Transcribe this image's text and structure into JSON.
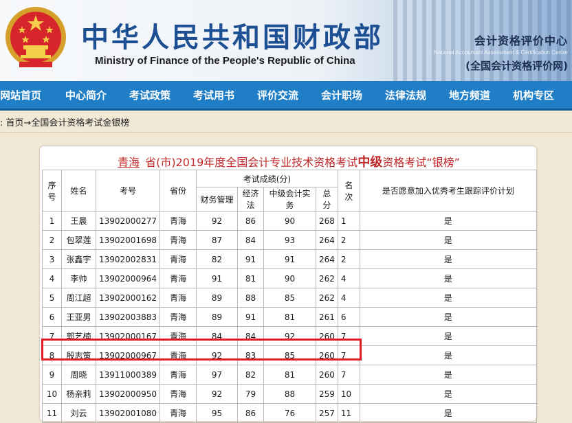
{
  "header": {
    "title_cn": "中华人民共和国财政部",
    "title_en": "Ministry of Finance of the People's Republic of China",
    "center_name": "会计资格评价中心",
    "center_en": "National Accountant Assessment & Certification Center",
    "center_site": "(全国会计资格评价网)",
    "emblem_icon": "national-emblem-icon"
  },
  "nav": [
    "网站首页",
    "中心简介",
    "考试政策",
    "考试用书",
    "评价交流",
    "会计职场",
    "法律法规",
    "地方频道",
    "机构专区"
  ],
  "breadcrumb": ": 首页→全国会计资格考试金银榜",
  "table_title": {
    "province": "青海",
    "prefix": "省(市)2019年度全国会计专业技术资格考试",
    "level": "中级",
    "suffix": "资格考试“银榜”"
  },
  "columns": {
    "seq": "序号",
    "name": "姓名",
    "id": "考号",
    "prov": "省份",
    "score_group": "考试成绩(分)",
    "s1": "财务管理",
    "s2": "经济法",
    "s3": "中级会计实务",
    "total": "总分",
    "rank": "名次",
    "follow": "是否愿意加入优秀考生跟踪评价计划"
  },
  "rows": [
    {
      "seq": "1",
      "name": "王晨",
      "id": "13902000277",
      "prov": "青海",
      "s1": "92",
      "s2": "86",
      "s3": "90",
      "total": "268",
      "rank": "1",
      "follow": "是"
    },
    {
      "seq": "2",
      "name": "包翠莲",
      "id": "13902001698",
      "prov": "青海",
      "s1": "87",
      "s2": "84",
      "s3": "93",
      "total": "264",
      "rank": "2",
      "follow": "是"
    },
    {
      "seq": "3",
      "name": "张鑫宇",
      "id": "13902002831",
      "prov": "青海",
      "s1": "82",
      "s2": "91",
      "s3": "91",
      "total": "264",
      "rank": "2",
      "follow": "是"
    },
    {
      "seq": "4",
      "name": "李帅",
      "id": "13902000964",
      "prov": "青海",
      "s1": "91",
      "s2": "81",
      "s3": "90",
      "total": "262",
      "rank": "4",
      "follow": "是"
    },
    {
      "seq": "5",
      "name": "周江超",
      "id": "13902000162",
      "prov": "青海",
      "s1": "89",
      "s2": "88",
      "s3": "85",
      "total": "262",
      "rank": "4",
      "follow": "是"
    },
    {
      "seq": "6",
      "name": "王亚男",
      "id": "13902003883",
      "prov": "青海",
      "s1": "89",
      "s2": "91",
      "s3": "81",
      "total": "261",
      "rank": "6",
      "follow": "是"
    },
    {
      "seq": "7",
      "name": "郭艺楠",
      "id": "13902000167",
      "prov": "青海",
      "s1": "84",
      "s2": "84",
      "s3": "92",
      "total": "260",
      "rank": "7",
      "follow": "是"
    },
    {
      "seq": "8",
      "name": "殷志策",
      "id": "13902000967",
      "prov": "青海",
      "s1": "92",
      "s2": "83",
      "s3": "85",
      "total": "260",
      "rank": "7",
      "follow": "是"
    },
    {
      "seq": "9",
      "name": "周晓",
      "id": "13911000389",
      "prov": "青海",
      "s1": "97",
      "s2": "82",
      "s3": "81",
      "total": "260",
      "rank": "7",
      "follow": "是"
    },
    {
      "seq": "10",
      "name": "杨亲莉",
      "id": "13902000950",
      "prov": "青海",
      "s1": "92",
      "s2": "79",
      "s3": "88",
      "total": "259",
      "rank": "10",
      "follow": "是"
    },
    {
      "seq": "11",
      "name": "刘云",
      "id": "13902001080",
      "prov": "青海",
      "s1": "95",
      "s2": "86",
      "s3": "76",
      "total": "257",
      "rank": "11",
      "follow": "是"
    }
  ],
  "highlight_color": "#e01b22"
}
